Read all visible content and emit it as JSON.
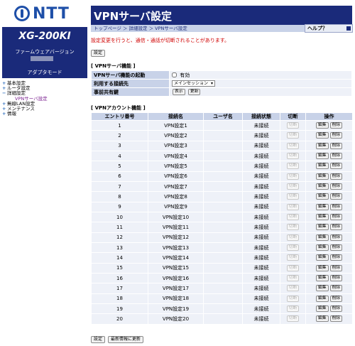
{
  "brand": {
    "logo_text": "NTT"
  },
  "sidebar": {
    "model": "XG-200KI",
    "fw_label": "ファームウェアバージョン",
    "mode": "アダプタモード",
    "nav": {
      "basic": "基本設定",
      "router": "ルータ設定",
      "detail": "詳細設定",
      "vpn_server": "VPNサーバ設定",
      "wlan": "無線LAN設定",
      "maintenance": "メンテナンス",
      "info": "情報"
    }
  },
  "header": {
    "title": "VPNサーバ設定",
    "breadcrumb": "トップページ ＞ 詳細設定 ＞ VPNサーバ設定",
    "help": "ヘルプ？"
  },
  "warning": "設定変更を行うと、通信・通話が切断されることがあります。",
  "buttons": {
    "top_apply": "設定",
    "bottom_apply": "設定",
    "refresh": "最新情報に更新",
    "show": "表示",
    "update": "更新"
  },
  "vpn_server": {
    "section_title": "[ VPNサーバ機能 ]",
    "enable_label": "VPNサーバ機能の起動",
    "enable_checkbox_text": "有効",
    "enabled": false,
    "connection_label": "利用する接続先",
    "connection_value": "メインセッション",
    "psk_label": "事前共有鍵"
  },
  "accounts": {
    "section_title": "[ VPNアカウント機能 ]",
    "headers": {
      "entry": "エントリ番号",
      "name": "接続名",
      "user": "ユーザ名",
      "status": "接続状態",
      "disconnect": "切断",
      "action": "操作"
    },
    "disconnect_label": "切断",
    "edit_label": "編集",
    "delete_label": "削除",
    "rows": [
      {
        "no": "1",
        "name": "VPN設定1",
        "user": "",
        "status": "未接続"
      },
      {
        "no": "2",
        "name": "VPN設定2",
        "user": "",
        "status": "未接続"
      },
      {
        "no": "3",
        "name": "VPN設定3",
        "user": "",
        "status": "未接続"
      },
      {
        "no": "4",
        "name": "VPN設定4",
        "user": "",
        "status": "未接続"
      },
      {
        "no": "5",
        "name": "VPN設定5",
        "user": "",
        "status": "未接続"
      },
      {
        "no": "6",
        "name": "VPN設定6",
        "user": "",
        "status": "未接続"
      },
      {
        "no": "7",
        "name": "VPN設定7",
        "user": "",
        "status": "未接続"
      },
      {
        "no": "8",
        "name": "VPN設定8",
        "user": "",
        "status": "未接続"
      },
      {
        "no": "9",
        "name": "VPN設定9",
        "user": "",
        "status": "未接続"
      },
      {
        "no": "10",
        "name": "VPN設定10",
        "user": "",
        "status": "未接続"
      },
      {
        "no": "11",
        "name": "VPN設定11",
        "user": "",
        "status": "未接続"
      },
      {
        "no": "12",
        "name": "VPN設定12",
        "user": "",
        "status": "未接続"
      },
      {
        "no": "13",
        "name": "VPN設定13",
        "user": "",
        "status": "未接続"
      },
      {
        "no": "14",
        "name": "VPN設定14",
        "user": "",
        "status": "未接続"
      },
      {
        "no": "15",
        "name": "VPN設定15",
        "user": "",
        "status": "未接続"
      },
      {
        "no": "16",
        "name": "VPN設定16",
        "user": "",
        "status": "未接続"
      },
      {
        "no": "17",
        "name": "VPN設定17",
        "user": "",
        "status": "未接続"
      },
      {
        "no": "18",
        "name": "VPN設定18",
        "user": "",
        "status": "未接続"
      },
      {
        "no": "19",
        "name": "VPN設定19",
        "user": "",
        "status": "未接続"
      },
      {
        "no": "20",
        "name": "VPN設定20",
        "user": "",
        "status": "未接続"
      }
    ]
  },
  "colors": {
    "brand_blue": "#1e4fa8",
    "navy": "#1a2a7a",
    "header_cell": "#c8d2e8",
    "value_cell": "#eef1f8",
    "warning": "#d00000"
  }
}
